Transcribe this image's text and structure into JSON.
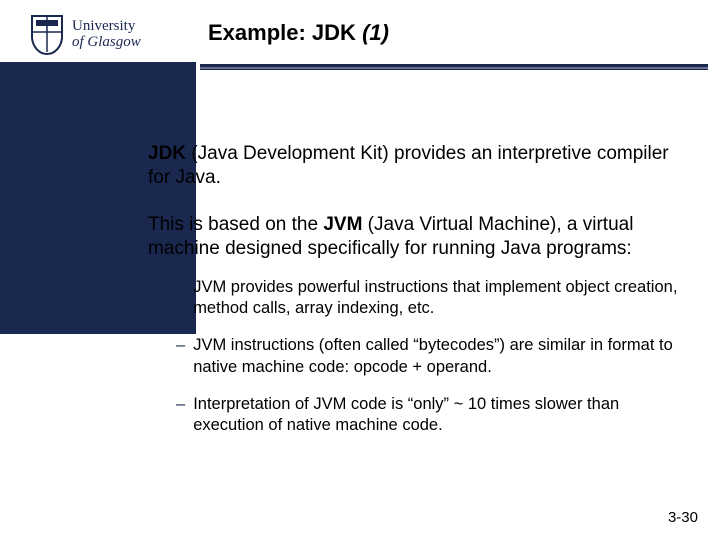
{
  "logo": {
    "line1": "University",
    "line2_prefix": "of",
    "line2_name": "Glasgow"
  },
  "title": {
    "prefix": "Example: JDK ",
    "paren": "(1)"
  },
  "bullets": [
    {
      "pre": "",
      "bold1": "JDK",
      "mid": " (Java Development Kit) provides an interpretive compiler for Java.",
      "sub": []
    },
    {
      "pre": "This is based on the ",
      "bold1": "JVM",
      "mid": " (Java Virtual Machine), a virtual machine designed specifically for running Java programs:",
      "sub": [
        "JVM provides powerful instructions that implement object creation, method calls, array indexing, etc.",
        "JVM instructions (often called “bytecodes”) are similar in format to native machine code: opcode + operand.",
        "Interpretation of JVM code is “only” ~ 10 times slower than execution of native machine code."
      ]
    }
  ],
  "page_number": "3-30"
}
